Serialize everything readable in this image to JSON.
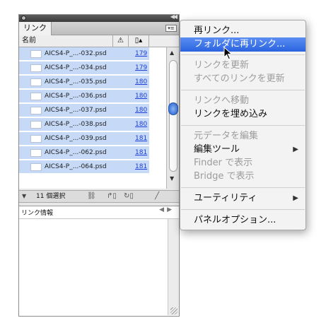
{
  "panel": {
    "tab_label": "リンク",
    "menu_button_icon": "panel-menu-icon",
    "col_name": "名前",
    "col_warning_icon": "warning-icon",
    "col_page_icon": "page-icon",
    "rows": [
      {
        "name": "AICS4-P_...-032.psd",
        "page": "179"
      },
      {
        "name": "AICS4-P_...-034.psd",
        "page": "179"
      },
      {
        "name": "AICS4-P_...-035.psd",
        "page": "180"
      },
      {
        "name": "AICS4-P_...-036.psd",
        "page": "180"
      },
      {
        "name": "AICS4-P_...-037.psd",
        "page": "180"
      },
      {
        "name": "AICS4-P_...-038.psd",
        "page": "180"
      },
      {
        "name": "AICS4-P_...-039.psd",
        "page": "181"
      },
      {
        "name": "AICS4-P_...-062.psd",
        "page": "181"
      },
      {
        "name": "AICS4-P_...-064.psd",
        "page": "181"
      }
    ],
    "selected_count": "11 個選択",
    "info_label": "リンク情報",
    "selection_color": "#c6d9f7",
    "page_link_color": "#1d3fd6"
  },
  "menu": {
    "items": [
      {
        "label": "再リンク...",
        "state": "normal"
      },
      {
        "label": "フォルダに再リンク...",
        "state": "highlighted"
      },
      {
        "label": "リンクを更新",
        "state": "disabled"
      },
      {
        "label": "すべてのリンクを更新",
        "state": "disabled"
      },
      {
        "label": "リンクへ移動",
        "state": "disabled"
      },
      {
        "label": "リンクを埋め込み",
        "state": "normal"
      },
      {
        "label": "元データを編集",
        "state": "disabled"
      },
      {
        "label": "編集ツール",
        "state": "normal",
        "submenu": true
      },
      {
        "label": "Finder で表示",
        "state": "disabled"
      },
      {
        "label": "Bridge で表示",
        "state": "disabled"
      },
      {
        "label": "ユーティリティ",
        "state": "normal",
        "submenu": true
      },
      {
        "label": "パネルオプション...",
        "state": "normal"
      }
    ],
    "highlight_color": "#2a63e0"
  }
}
